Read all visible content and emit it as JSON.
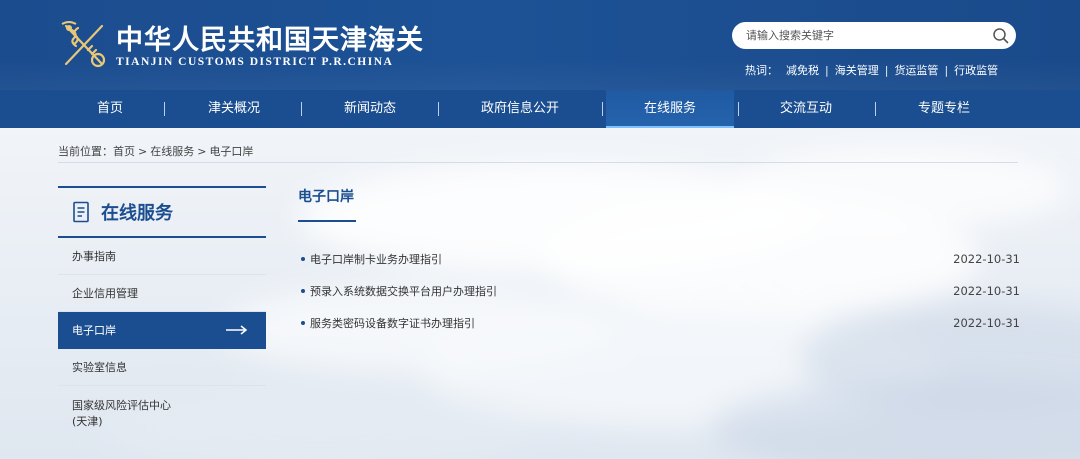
{
  "header": {
    "title": "中华人民共和国天津海关",
    "subtitle": "TIANJIN CUSTOMS DISTRICT P.R.CHINA",
    "search_placeholder": "请输入搜索关键字",
    "hotwords_label": "热词：",
    "hotwords": [
      "减免税",
      "海关管理",
      "货运监管",
      "行政监管"
    ]
  },
  "nav": {
    "items": [
      "首页",
      "津关概况",
      "新闻动态",
      "政府信息公开",
      "在线服务",
      "交流互动",
      "专题专栏"
    ],
    "active": "在线服务"
  },
  "breadcrumb": {
    "label": "当前位置：",
    "items": [
      "首页",
      "在线服务",
      "电子口岸"
    ],
    "separator": ">"
  },
  "sidebar": {
    "title": "在线服务",
    "items": [
      "办事指南",
      "企业信用管理",
      "电子口岸",
      "实验室信息",
      "国家级风险评估中心(天津)"
    ],
    "active": "电子口岸"
  },
  "main": {
    "title": "电子口岸",
    "articles": [
      {
        "title": "电子口岸制卡业务办理指引",
        "date": "2022-10-31"
      },
      {
        "title": "预录入系统数据交换平台用户办理指引",
        "date": "2022-10-31"
      },
      {
        "title": "服务类密码设备数字证书办理指引",
        "date": "2022-10-31"
      }
    ]
  },
  "colors": {
    "brand_blue": "#1b4e90",
    "nav_active_underline": "#7fc1ff"
  }
}
